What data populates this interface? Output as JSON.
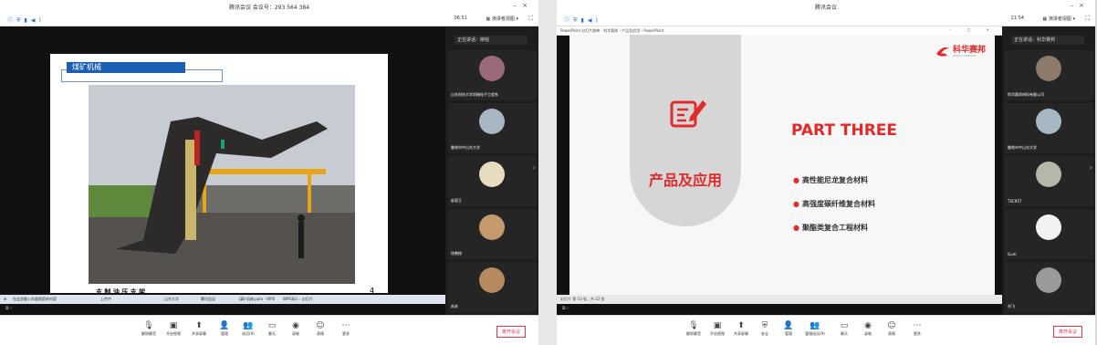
{
  "window1": {
    "title": "腾讯会议 会议号：293 564 384",
    "clock": "06:51",
    "layout_label": "演讲者视图",
    "speaker": "正在讲话：柳柏",
    "slide": {
      "heading": "煤矿机械",
      "page_number": "4",
      "caption": "支 制 油 压 支 架"
    },
    "taskbar_items": [
      "在这里输入你要搜索的内容",
      "上传中",
      "山东大学",
      "腾讯会议",
      "煤矿机械.pptx - WPS",
      "WPS演示 - 幻灯片"
    ],
    "participants": [
      {
        "name": "山东科技大学机械电子工程系"
      },
      {
        "name": "鲁地市中山东大学"
      },
      {
        "name": "赵君王"
      },
      {
        "name": "徐教授"
      },
      {
        "name": "苏苏"
      }
    ]
  },
  "window2": {
    "title": "腾讯会议",
    "clock": "21:54",
    "layout_label": "演讲者视图",
    "speaker": "正在讲话：科华赛邦",
    "ppt_bar": "PowerPoint 幻灯片放映 - 科华赛邦 - 产品及应用 - PowerPoint",
    "slide": {
      "logo": "科华赛邦",
      "logo_sub": "KEHUA SAIBANG",
      "part": "PART THREE",
      "section": "产品及应用",
      "bullets": [
        "高性能尼龙复合材料",
        "高强度碳纤维复合材料",
        "聚酯类复合工程材料"
      ]
    },
    "status": "幻灯片 第 10 张，共 22 张",
    "participants": [
      {
        "name": "科华赛邦材料有限公司"
      },
      {
        "name": "鲁地市中山东大学"
      },
      {
        "name": "TSC957"
      },
      {
        "name": "Gum"
      },
      {
        "name": "刘飞"
      }
    ]
  },
  "bottombar1": [
    "解除静音",
    "开启视频",
    "共享屏幕",
    "管理",
    "成员(9)",
    "聊天",
    "录制",
    "表情",
    "更多"
  ],
  "bottombar2": [
    "解除静音",
    "开启视频",
    "共享屏幕",
    "安全",
    "管理",
    "管理成员(9)",
    "聊天",
    "录制",
    "表情",
    "更多"
  ],
  "leave_label": "离开会议",
  "colors": {
    "accent_red": "#e12a2a",
    "leave_red": "#ee3344",
    "slide_blue": "#1a5fb4"
  }
}
